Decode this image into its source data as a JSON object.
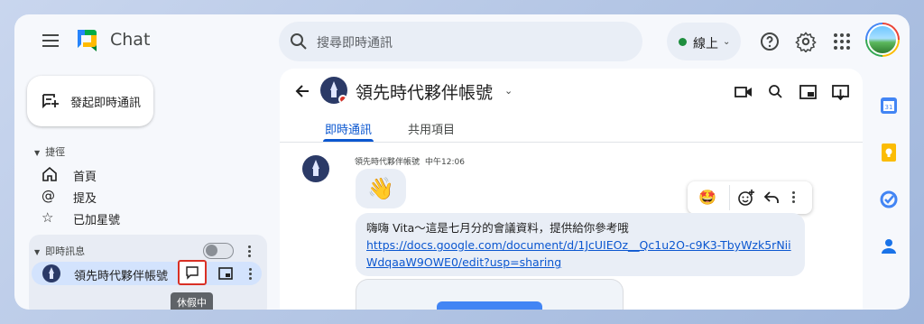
{
  "app": {
    "brand": "Chat"
  },
  "search": {
    "placeholder": "搜尋即時通訊"
  },
  "status": {
    "label": "線上",
    "color": "#1e8e3e"
  },
  "sidebar": {
    "new_chat_label": "發起即時通訊",
    "shortcuts_header": "捷徑",
    "shortcuts": [
      {
        "label": "首頁",
        "icon": "home-icon"
      },
      {
        "label": "提及",
        "icon": "at-icon"
      },
      {
        "label": "已加星號",
        "icon": "star-icon"
      }
    ],
    "dm_header": "即時訊息",
    "dm_item": {
      "name": "領先時代夥伴帳號"
    },
    "tooltip": "休假中"
  },
  "chat": {
    "title": "領先時代夥伴帳號",
    "tabs": [
      {
        "label": "即時通訊",
        "active": true
      },
      {
        "label": "共用項目",
        "active": false
      }
    ],
    "message": {
      "sender": "領先時代夥伴帳號",
      "time": "中午12:06",
      "emoji": "👋",
      "text": "嗨嗨 Vita～這是七月分的會議資料，提供給你參考哦",
      "link": "https://docs.google.com/document/d/1JcUIEOz__Qc1u2O-c9K3-TbyWzk5rNiiWdqaaW9OWE0/edit?usp=sharing"
    },
    "reaction_emoji": "🤩"
  },
  "colors": {
    "accent": "#0b57d0",
    "highlight": "#d3e3fd",
    "alert": "#d93025"
  }
}
